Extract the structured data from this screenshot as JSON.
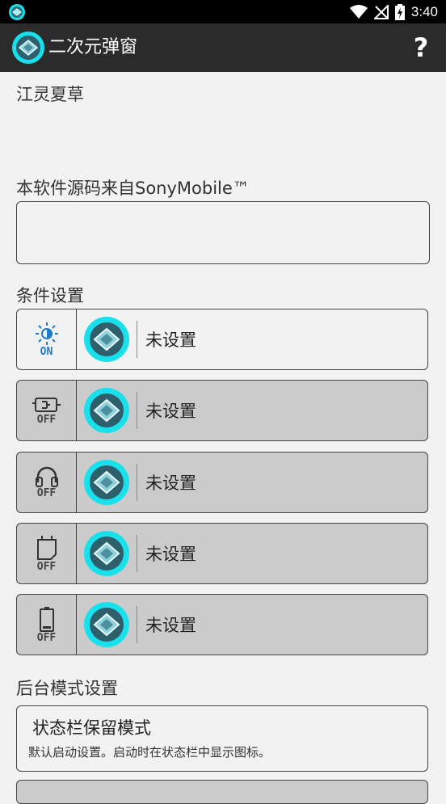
{
  "status_bar": {
    "time": "3:40"
  },
  "app_bar": {
    "title": "二次元弹窗",
    "help_label": "?"
  },
  "header_text": "江灵夏草",
  "source_note": "本软件源码来自SonyMobile™",
  "condition_section": {
    "title": "条件设置",
    "rows": [
      {
        "icon": "brightness-icon",
        "state": "ON",
        "label": "未设置",
        "active": true
      },
      {
        "icon": "charger-plug-icon",
        "state": "OFF",
        "label": "未设置",
        "active": false
      },
      {
        "icon": "headphones-icon",
        "state": "OFF",
        "label": "未设置",
        "active": false
      },
      {
        "icon": "sd-card-icon",
        "state": "OFF",
        "label": "未设置",
        "active": false
      },
      {
        "icon": "battery-icon",
        "state": "OFF",
        "label": "未设置",
        "active": false
      }
    ]
  },
  "background_section": {
    "title": "后台模式设置",
    "modes": [
      {
        "title": "状态栏保留模式",
        "description": "默认启动设置。启动时在状态栏中显示图标。"
      }
    ]
  },
  "colors": {
    "accent": "#1e7bc9",
    "app_bar": "#2b2b2b",
    "disabled_row": "#cbcbcb",
    "logo_glow": "#19e0ea"
  }
}
